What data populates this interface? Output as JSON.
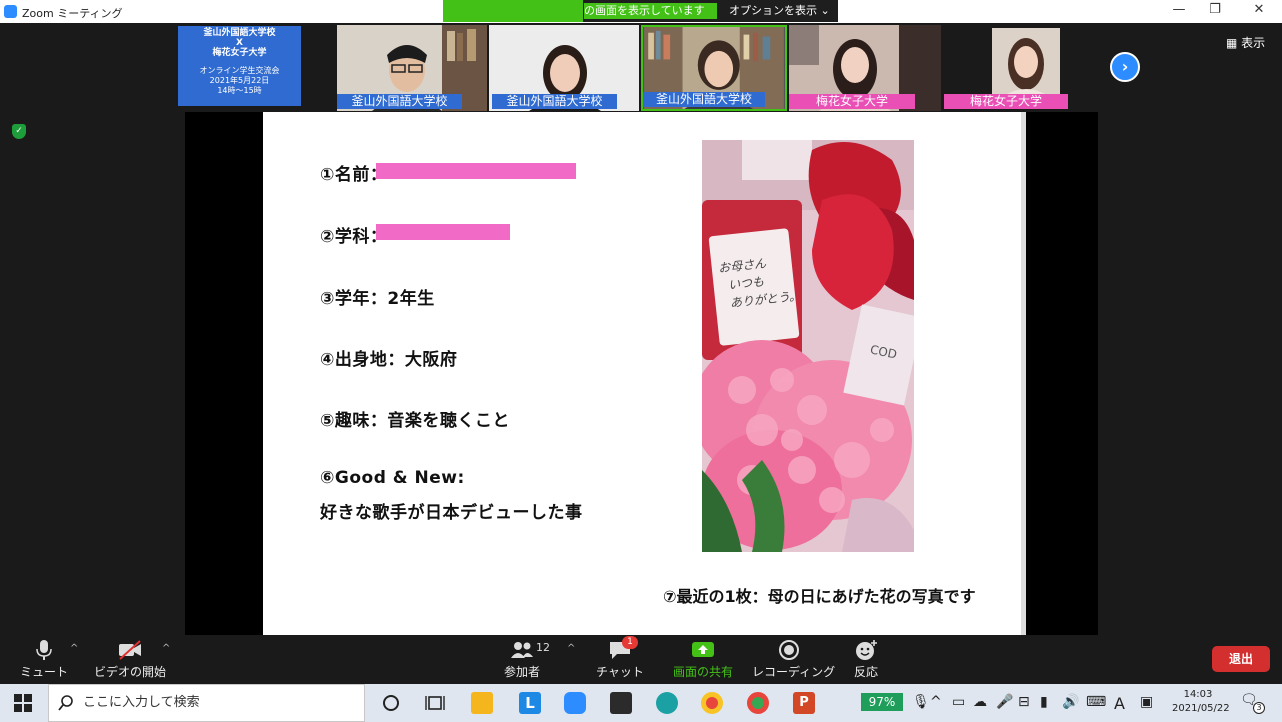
{
  "window": {
    "title": "Zoom ミーティング"
  },
  "share_bar": {
    "message": "の画面を表示しています",
    "options_label": "オプションを表示"
  },
  "gallery": {
    "info_tile": {
      "line1": "釜山外国語大学校",
      "line2": "X",
      "line3": "梅花女子大学",
      "line4": "オンライン学生交流会",
      "line5": "2021年5月22日",
      "line6": "14時〜15時"
    },
    "participants": [
      {
        "name": "釜山外国語大学校"
      },
      {
        "name": "釜山外国語大学校"
      },
      {
        "name": "釜山外国語大学校"
      },
      {
        "name": "梅花女子大学"
      },
      {
        "name": "梅花女子大学"
      }
    ],
    "view_label": "表示"
  },
  "slide": {
    "line_name": "①名前：",
    "line_dept": "②学科：",
    "line_year": "③学年：2年生",
    "line_home": "④出身地：大阪府",
    "line_hobby": "⑤趣味：音楽を聴くこと",
    "line_good": "⑥Good & New:",
    "line_good2": "好きな歌手が日本デビューした事",
    "card_text1": "お母さん",
    "card_text2": "いつも",
    "card_text3": "ありがとう。",
    "box_text": "COD",
    "caption": "⑦最近の1枚：母の日にあげた花の写真です"
  },
  "toolbar": {
    "mute": "ミュート",
    "video": "ビデオの開始",
    "participants": "参加者",
    "participant_count": "12",
    "chat": "チャット",
    "chat_badge": "1",
    "share": "画面の共有",
    "record": "レコーディング",
    "reactions": "反応",
    "leave": "退出"
  },
  "taskbar": {
    "search_placeholder": "ここに入力して検索",
    "battery": "97%",
    "time": "14:03",
    "date": "2021/05/22",
    "ime": "A",
    "notifications": "3"
  }
}
